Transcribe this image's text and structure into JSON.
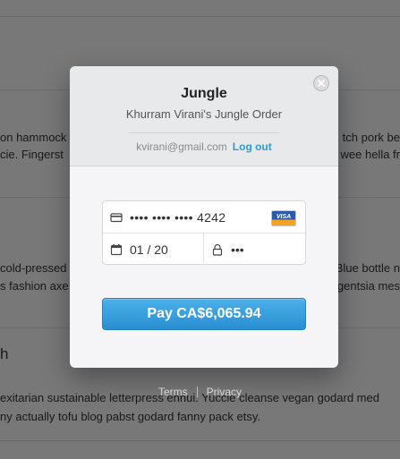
{
  "background": {
    "lines": [
      {
        "left": "on hammock",
        "right": "tch pork be"
      },
      {
        "left": "cie. Fingerst",
        "right": "wee hella fr"
      },
      {
        "left": "cold-pressed",
        "right": "Blue bottle n"
      },
      {
        "left": "s fashion axe",
        "right": "gentsia mes"
      }
    ],
    "heading": "h",
    "paragraph": [
      "exitarian sustainable letterpress ennui. Yuccie cleanse vegan godard med",
      "ny actually tofu blog pabst godard fanny pack etsy."
    ]
  },
  "checkout": {
    "merchant": "Jungle",
    "description": "Khurram Virani's Jungle Order",
    "email": "kvirani@gmail.com",
    "logout_label": "Log out",
    "card_number": "•••• •••• •••• 4242",
    "card_brand": "VISA",
    "expiry": "01 / 20",
    "cvc": "•••",
    "pay_label": "Pay CA$6,065.94",
    "icons": {
      "close": "close-icon",
      "card": "credit-card-icon",
      "calendar": "calendar-icon",
      "lock": "lock-icon"
    },
    "colors": {
      "accent": "#2e9ad6",
      "pay_button": "#3aa1e0"
    }
  },
  "footer": {
    "terms": "Terms",
    "privacy": "Privacy"
  }
}
